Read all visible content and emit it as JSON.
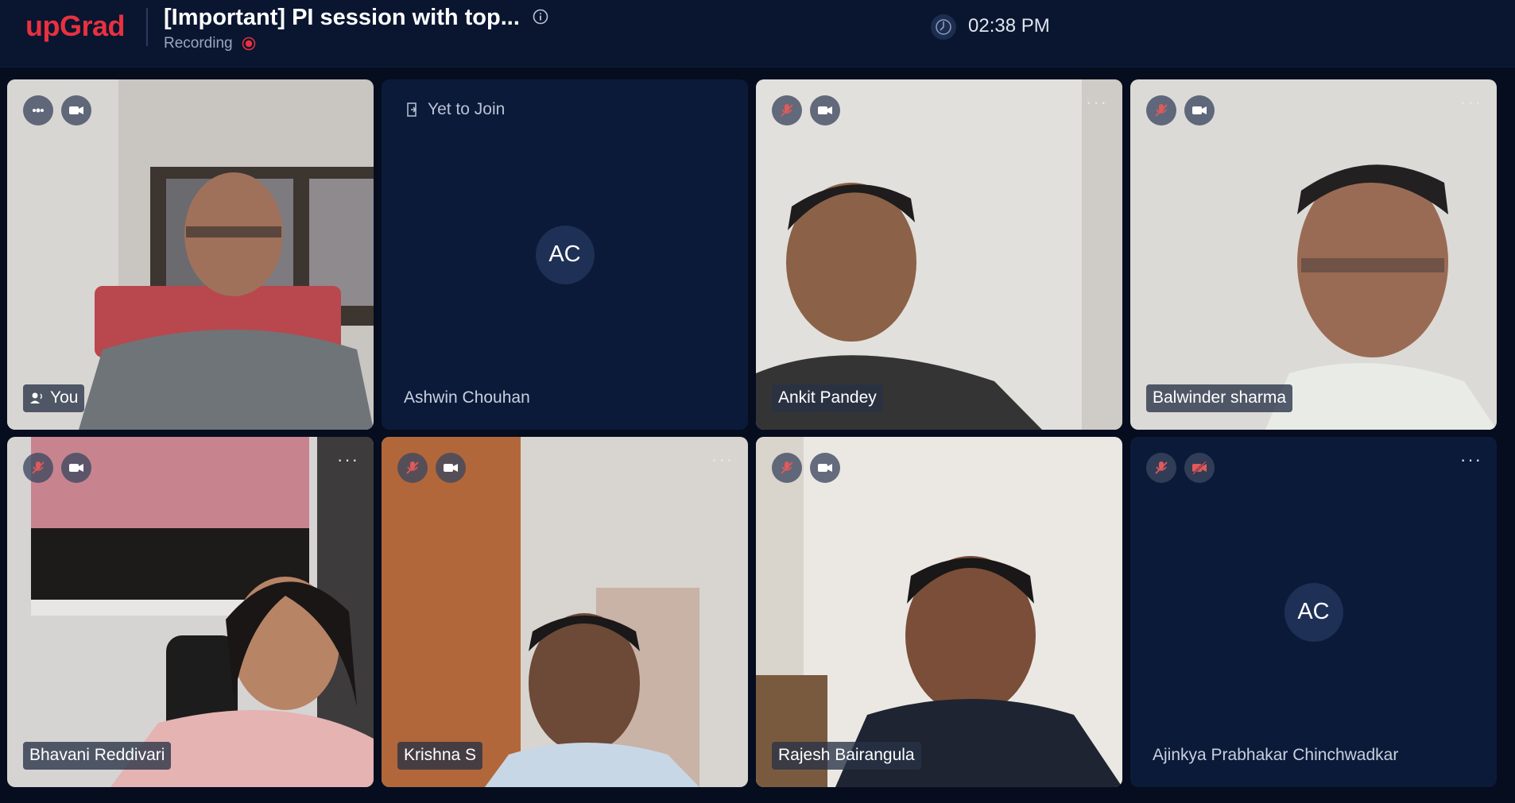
{
  "header": {
    "logo": "upGrad",
    "title": "[Important] PI session with top...",
    "recording_label": "Recording",
    "time": "02:38 PM"
  },
  "tiles": [
    {
      "name": "You",
      "state": "video",
      "initials": ""
    },
    {
      "name": "Ashwin Chouhan",
      "state": "yet-to-join",
      "status": "Yet to Join",
      "initials": "AC"
    },
    {
      "name": "Ankit Pandey",
      "state": "video",
      "initials": ""
    },
    {
      "name": "Balwinder sharma",
      "state": "video",
      "initials": ""
    },
    {
      "name": "Bhavani Reddivari",
      "state": "video",
      "initials": ""
    },
    {
      "name": "Krishna S",
      "state": "video",
      "initials": ""
    },
    {
      "name": "Rajesh Bairangula",
      "state": "video",
      "initials": ""
    },
    {
      "name": "Ajinkya Prabhakar Chinchwadkar",
      "state": "video-off",
      "initials": "AC"
    }
  ],
  "more_symbol": "···",
  "colors": {
    "brand": "#e8313f",
    "background": "#050d1f",
    "tile": "#0c1a3a",
    "muted_red": "#e05a5a"
  },
  "icons": {
    "mic_active": "audio-levels-icon",
    "mic_muted": "mic-muted-icon",
    "camera": "camera-icon",
    "camera_off": "camera-off-icon",
    "speaker": "speaking-icon",
    "join": "enter-icon",
    "clock": "clock-icon",
    "info": "info-icon"
  }
}
